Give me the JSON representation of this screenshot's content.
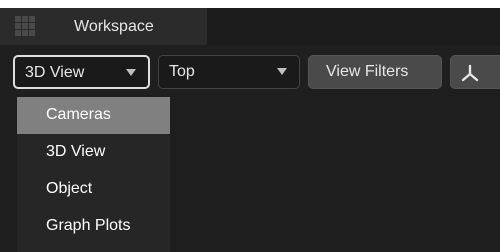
{
  "tab": {
    "icon": "grid-icon",
    "label": "Workspace"
  },
  "toolbar": {
    "view_dropdown": {
      "selected": "3D View"
    },
    "orientation_dropdown": {
      "selected": "Top"
    },
    "view_filters_label": "View Filters",
    "axis_icon": "axis-icon"
  },
  "menu": {
    "items": [
      {
        "label": "Cameras",
        "selected": true
      },
      {
        "label": "3D View",
        "selected": false
      },
      {
        "label": "Object",
        "selected": false
      },
      {
        "label": "Graph Plots",
        "selected": false
      }
    ]
  },
  "colors": {
    "background": "#1e1e1e",
    "tab_active": "#2b2b2b",
    "button": "#4a4a4a",
    "menu_selected": "#808080"
  }
}
